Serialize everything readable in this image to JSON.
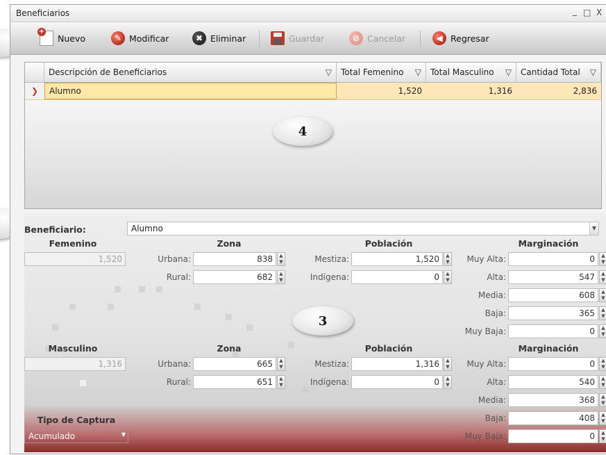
{
  "window": {
    "title": "Beneficiarios",
    "controls": [
      "_",
      "□",
      "X"
    ]
  },
  "toolbar": {
    "nuevo": "Nuevo",
    "modificar": "Modificar",
    "eliminar": "Eliminar",
    "guardar": "Guardar",
    "cancelar": "Cancelar",
    "regresar": "Regresar"
  },
  "grid": {
    "columns": [
      "Descripción de Beneficiarios",
      "Total Femenino",
      "Total Masculino",
      "Cantidad Total"
    ],
    "rows": [
      {
        "descripcion": "Alumno",
        "femenino": "1,520",
        "masculino": "1,316",
        "total": "2,836"
      }
    ]
  },
  "callouts": {
    "grid": "4",
    "form": "3"
  },
  "form": {
    "beneficiario_label": "Beneficiario:",
    "beneficiario_value": "Alumno",
    "headers": {
      "zona": "Zona",
      "poblacion": "Población",
      "marginacion": "Marginación"
    },
    "labels": {
      "urbana": "Urbana:",
      "rural": "Rural:",
      "mestiza": "Mestiza:",
      "indigena": "Indígena:",
      "muy_alta": "Muy Alta:",
      "alta": "Alta:",
      "media": "Media:",
      "baja": "Baja:",
      "muy_baja": "Muy Baja:"
    },
    "femenino": {
      "title": "Femenino",
      "total": "1,520",
      "urbana": "838",
      "rural": "682",
      "mestiza": "1,520",
      "indigena": "0",
      "muy_alta": "0",
      "alta": "547",
      "media": "608",
      "baja": "365",
      "muy_baja": "0"
    },
    "masculino": {
      "title": "Masculino",
      "total": "1,316",
      "urbana": "665",
      "rural": "651",
      "mestiza": "1,316",
      "indigena": "0",
      "muy_alta": "0",
      "alta": "540",
      "media": "368",
      "baja": "408",
      "muy_baja": "0"
    },
    "tipo_captura_label": "Tipo de Captura",
    "tipo_captura_value": "Acumulado"
  },
  "colors": {
    "selected_row": "#fde6b8",
    "accent_red": "#c0392b",
    "footer_red": "#8a2a2a"
  }
}
